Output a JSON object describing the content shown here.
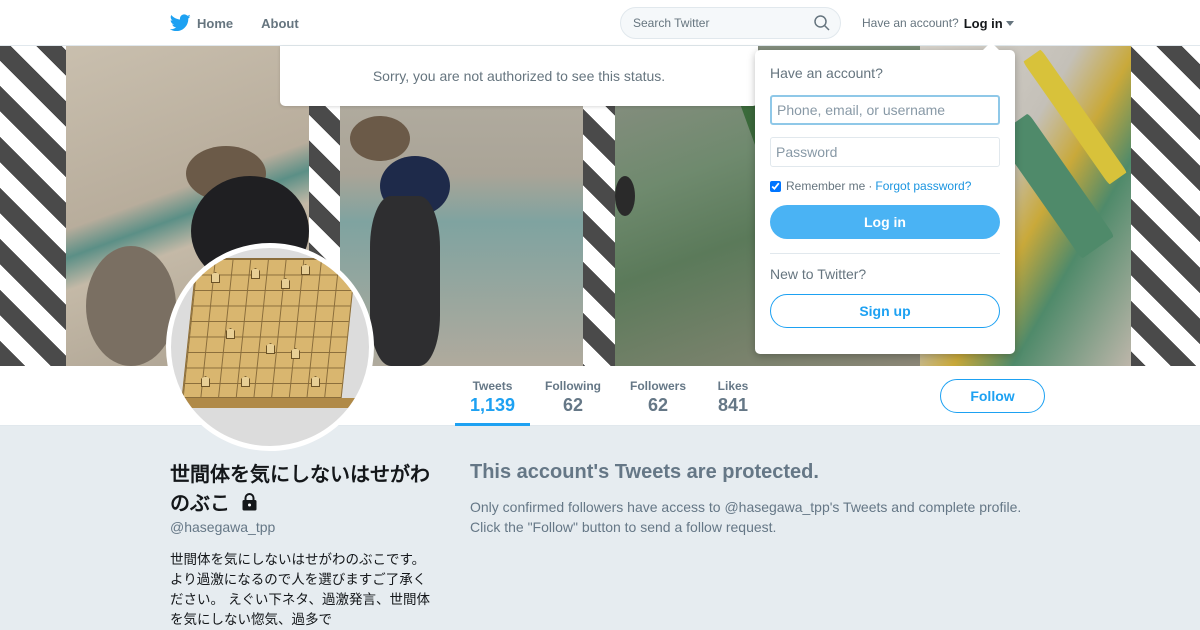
{
  "nav": {
    "home_label": "Home",
    "about_label": "About",
    "search_placeholder": "Search Twitter",
    "have_account": "Have an account?",
    "login_label": "Log in"
  },
  "banner": {
    "notice": "Sorry, you are not authorized to see this status."
  },
  "stats": {
    "tweets_label": "Tweets",
    "tweets_value": "1,139",
    "following_label": "Following",
    "following_value": "62",
    "followers_label": "Followers",
    "followers_value": "62",
    "likes_label": "Likes",
    "likes_value": "841"
  },
  "follow_button": "Follow",
  "login_dropdown": {
    "title": "Have an account?",
    "username_placeholder": "Phone, email, or username",
    "password_placeholder": "Password",
    "remember_label": "Remember me",
    "separator": "·",
    "forgot_label": "Forgot password?",
    "login_button": "Log in",
    "new_label": "New to Twitter?",
    "signup_button": "Sign up"
  },
  "profile": {
    "name": "世間体を気にしないはせがわのぶこ",
    "handle": "@hasegawa_tpp",
    "bio": "世間体を気にしないはせがわのぶこです。 より過激になるので人を選びますご了承ください。 えぐい下ネタ、過激発言、世間体を気にしない惚気、過多で"
  },
  "protected": {
    "title": "This account's Tweets are protected.",
    "line1": "Only confirmed followers have access to @hasegawa_tpp's Tweets and complete profile.",
    "line2": "Click the \"Follow\" button to send a follow request."
  },
  "colors": {
    "accent": "#1da1f2",
    "login_button": "#4ab3f4",
    "background": "#e6ecf0",
    "muted_text": "#657786"
  }
}
